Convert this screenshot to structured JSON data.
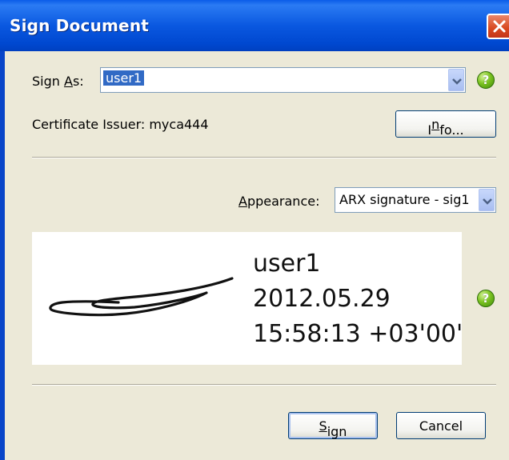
{
  "window": {
    "title": "Sign Document"
  },
  "sign_as": {
    "label": "Sign As:",
    "label_accesskey_index": 5,
    "value": "user1"
  },
  "certificate": {
    "issuer_text": "Certificate Issuer: myca444",
    "info_button_prefix": "I",
    "info_button_accesskey": "n",
    "info_button_suffix": "fo..."
  },
  "appearance": {
    "label_accesskey": "A",
    "label_rest": "ppearance:",
    "selected": "ARX signature - sig1"
  },
  "preview": {
    "name": "user1",
    "date": "2012.05.29",
    "time": "15:58:13 +03'00'"
  },
  "buttons": {
    "sign_accesskey": "S",
    "sign_rest": "ign",
    "cancel": "Cancel"
  },
  "colors": {
    "titlebar": "#0a58e0",
    "dialog_bg": "#ece9d8",
    "selection": "#316ac5",
    "help_green": "#7cc321"
  },
  "icons": {
    "close": "close-icon",
    "help": "help-icon",
    "dropdown": "chevron-down-icon",
    "signature": "handwritten-signature"
  }
}
